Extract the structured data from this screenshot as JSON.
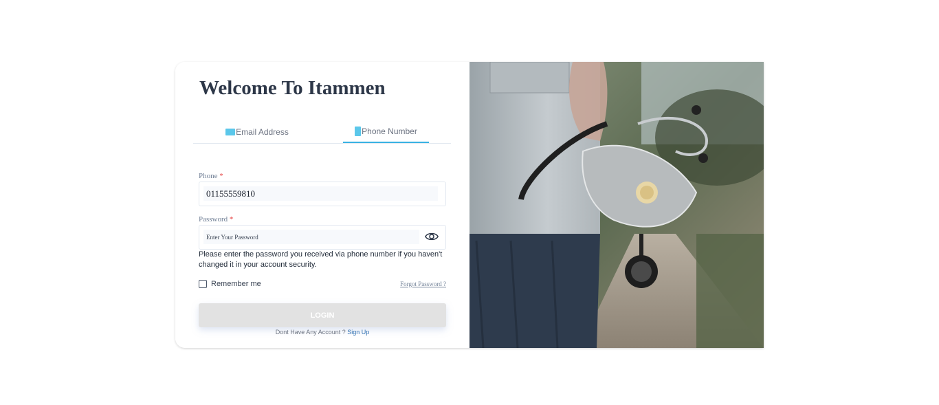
{
  "page": {
    "title": "Welcome To Itammen"
  },
  "tabs": [
    {
      "label": "Email Address",
      "icon": "email-icon",
      "active": false
    },
    {
      "label": "Phone Number",
      "icon": "phone-icon",
      "active": true
    }
  ],
  "form": {
    "phone_label": "Phone",
    "phone_required": "*",
    "phone_value": "01155559810",
    "password_label": "Password",
    "password_required": "*",
    "password_placeholder": "Enter Your Password",
    "password_hint": "Please enter the password you received via phone number if you haven't changed it in your account security.",
    "remember_label": "Remember me",
    "remember_checked": false,
    "forgot_label": "Forgot Password ?",
    "login_label": "LOGIN",
    "signup_prompt": "Dont Have Any Account ?",
    "signup_link": "Sign Up"
  },
  "colors": {
    "accent": "#38b2e3",
    "title": "#2d3748",
    "required": "#e53e3e",
    "link": "#2b6cb0",
    "button_disabled": "#e2e2e2"
  }
}
